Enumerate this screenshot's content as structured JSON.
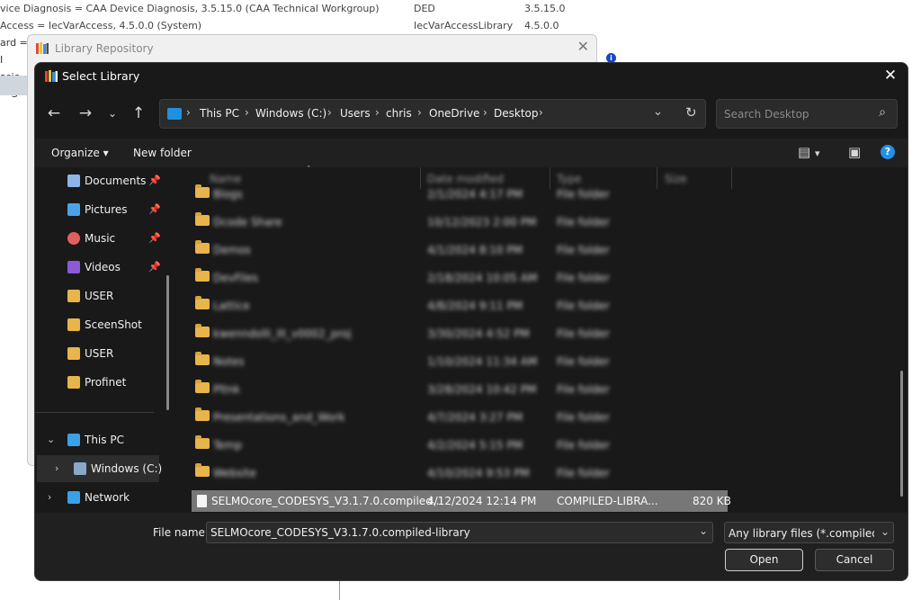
{
  "background": {
    "rows": [
      {
        "name": "vice Diagnosis = CAA Device Diagnosis, 3.5.15.0 (CAA Technical Workgroup)",
        "namespace": "DED",
        "version": "3.5.15.0"
      },
      {
        "name": "Access = IecVarAccess, 4.5.0.0 (System)",
        "namespace": "IecVarAccessLibrary",
        "version": "4.5.0.0"
      }
    ],
    "left_fragments": [
      "ard = I",
      "asic = S"
    ]
  },
  "repository_dialog": {
    "title": "Library Repository"
  },
  "select_dialog": {
    "title": "Select Library",
    "address": {
      "crumbs": [
        "This PC",
        "Windows (C:)",
        "Users",
        "chris",
        "OneDrive",
        "Desktop"
      ]
    },
    "search": {
      "placeholder": "Search Desktop"
    },
    "toolbar": {
      "organize": "Organize",
      "new_folder": "New folder"
    },
    "nav": {
      "quick_access": [
        {
          "label": "Documents",
          "icon": "documents-icon",
          "color": "#8fb4e8",
          "pinned": true
        },
        {
          "label": "Pictures",
          "icon": "pictures-icon",
          "color": "#4aa3e8",
          "pinned": true
        },
        {
          "label": "Music",
          "icon": "music-icon",
          "color": "#e06060",
          "pinned": true
        },
        {
          "label": "Videos",
          "icon": "videos-icon",
          "color": "#8a5ad8",
          "pinned": true
        },
        {
          "label": "USER",
          "icon": "folder-icon",
          "color": "#e8b54a",
          "pinned": false
        },
        {
          "label": "SceenShot",
          "icon": "folder-icon",
          "color": "#e8b54a",
          "pinned": false
        },
        {
          "label": "USER",
          "icon": "folder-icon",
          "color": "#e8b54a",
          "pinned": false
        },
        {
          "label": "Profinet",
          "icon": "folder-icon",
          "color": "#e8b54a",
          "pinned": false
        }
      ],
      "this_pc": "This PC",
      "windows_c": "Windows (C:)",
      "network": "Network"
    },
    "columns": [
      "Name",
      "Date modified",
      "Type",
      "Size"
    ],
    "blurred_folders": [
      {
        "name": "Blogs",
        "date": "2/1/2024 4:17 PM",
        "type": "File folder"
      },
      {
        "name": "Dcode Share",
        "date": "10/12/2023 2:00 PM",
        "type": "File folder"
      },
      {
        "name": "Demos",
        "date": "4/1/2024 8:10 PM",
        "type": "File folder"
      },
      {
        "name": "DevFiles",
        "date": "2/18/2024 10:05 AM",
        "type": "File folder"
      },
      {
        "name": "Lattice",
        "date": "4/8/2024 9:11 PM",
        "type": "File folder"
      },
      {
        "name": "kwenndolli_III_v0002_proj",
        "date": "3/30/2024 4:52 PM",
        "type": "File folder"
      },
      {
        "name": "Notes",
        "date": "1/10/2024 11:34 AM",
        "type": "File folder"
      },
      {
        "name": "Pltnk",
        "date": "3/28/2024 10:42 PM",
        "type": "File folder"
      },
      {
        "name": "Presentations_and_Work",
        "date": "4/7/2024 3:27 PM",
        "type": "File folder"
      },
      {
        "name": "Temp",
        "date": "4/2/2024 5:15 PM",
        "type": "File folder"
      },
      {
        "name": "Website",
        "date": "4/10/2024 9:53 PM",
        "type": "File folder"
      }
    ],
    "selected_file": {
      "name": "SELMOcore_CODESYS_V3.1.7.0.compiled...",
      "date": "4/12/2024 12:14 PM",
      "type": "COMPILED-LIBRA...",
      "size": "820 KB"
    },
    "footer": {
      "file_name_label": "File name:",
      "file_name_value": "SELMOcore_CODESYS_V3.1.7.0.compiled-library",
      "filter_value": "Any library files (*.compiled-lib",
      "open": "Open",
      "cancel": "Cancel"
    }
  }
}
